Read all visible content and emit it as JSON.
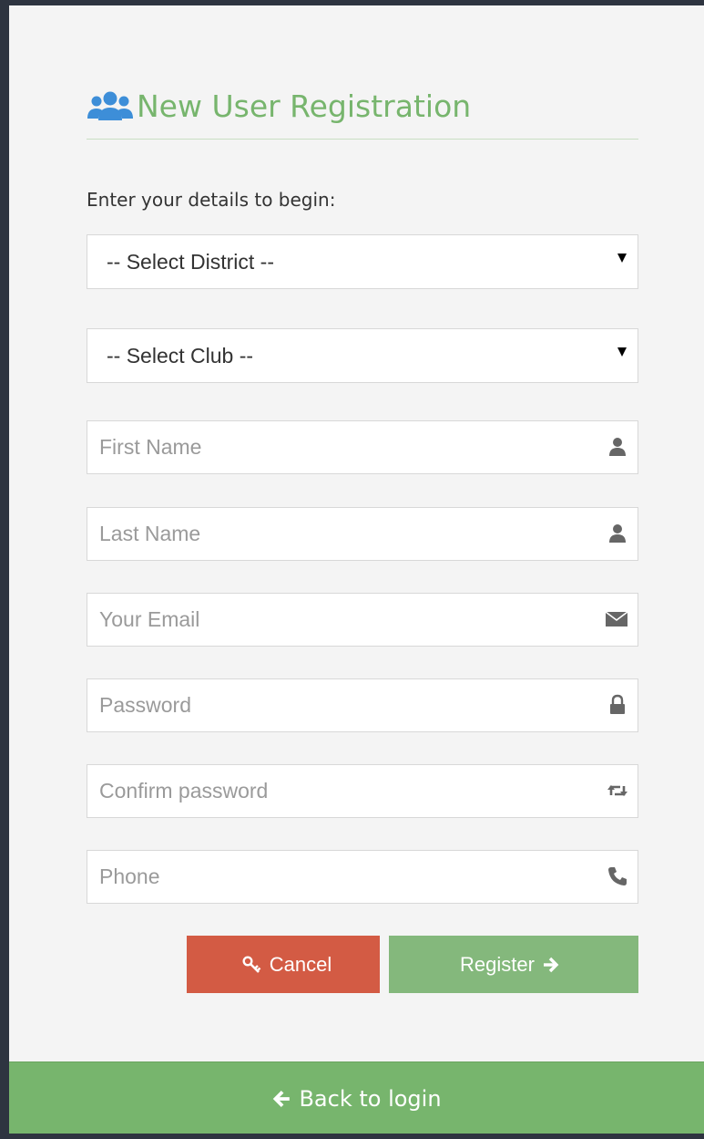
{
  "header": {
    "title": "New User Registration",
    "icon": "users-icon"
  },
  "form": {
    "intro": "Enter your details to begin:",
    "district_select": {
      "value": "-- Select District --"
    },
    "club_select": {
      "value": "-- Select Club --"
    },
    "first_name": {
      "placeholder": "First Name",
      "icon": "user-icon"
    },
    "last_name": {
      "placeholder": "Last Name",
      "icon": "user-icon"
    },
    "email": {
      "placeholder": "Your Email",
      "icon": "envelope-icon"
    },
    "password": {
      "placeholder": "Password",
      "icon": "lock-icon"
    },
    "confirm_password": {
      "placeholder": "Confirm password",
      "icon": "retweet-icon"
    },
    "phone": {
      "placeholder": "Phone",
      "icon": "phone-icon"
    }
  },
  "actions": {
    "cancel_label": "Cancel",
    "register_label": "Register"
  },
  "footer": {
    "back_label": "Back to login"
  },
  "colors": {
    "accent_green": "#77b56d",
    "register_green": "#84b87c",
    "cancel_red": "#d35b44",
    "frame": "#2e3440",
    "panel": "#f4f4f4"
  }
}
